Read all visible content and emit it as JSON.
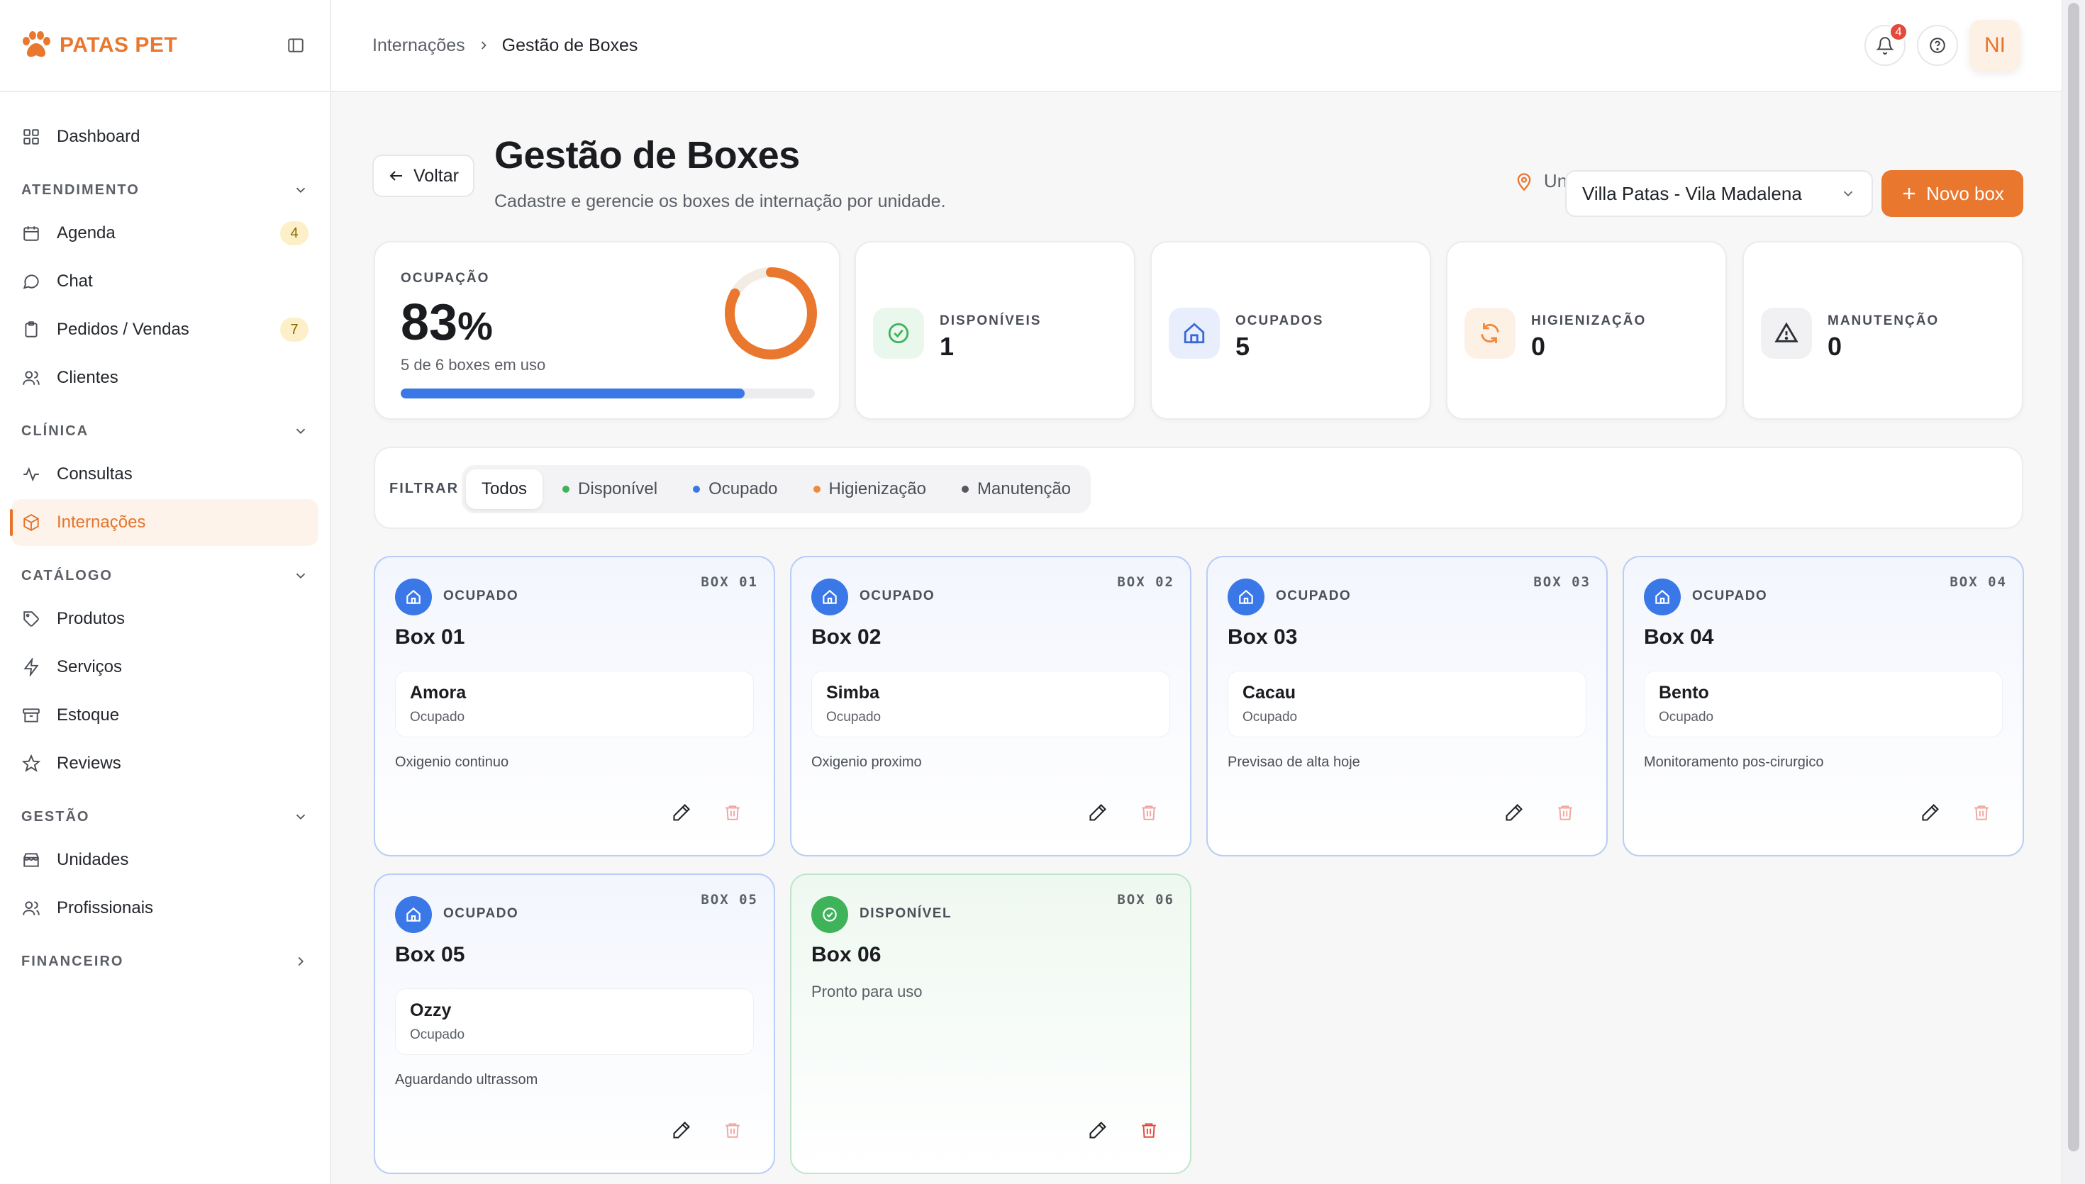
{
  "brand": {
    "name": "PATAS PET"
  },
  "sidebar": {
    "dashboard": "Dashboard",
    "sections": {
      "atendimento": "ATENDIMENTO",
      "clinica": "CLÍNICA",
      "catalogo": "CATÁLOGO",
      "gestao": "GESTÃO",
      "financeiro": "FINANCEIRO"
    },
    "items": {
      "agenda": {
        "label": "Agenda",
        "badge": "4"
      },
      "chat": {
        "label": "Chat"
      },
      "pedidos": {
        "label": "Pedidos / Vendas",
        "badge": "7"
      },
      "clientes": {
        "label": "Clientes"
      },
      "consultas": {
        "label": "Consultas"
      },
      "internacoes": {
        "label": "Internações"
      },
      "produtos": {
        "label": "Produtos"
      },
      "servicos": {
        "label": "Serviços"
      },
      "estoque": {
        "label": "Estoque"
      },
      "reviews": {
        "label": "Reviews"
      },
      "unidades": {
        "label": "Unidades"
      },
      "profissionais": {
        "label": "Profissionais"
      }
    }
  },
  "topbar": {
    "breadcrumb": [
      "Internações",
      "Gestão de Boxes"
    ],
    "notifications_count": "4",
    "avatar_initials": "NI"
  },
  "page": {
    "back_label": "Voltar",
    "title": "Gestão de Boxes",
    "subtitle": "Cadastre e gerencie os boxes de internação por unidade.",
    "unit_label": "Unidade:",
    "unit_value": "Villa Patas - Vila Madalena",
    "new_box_label": "Novo box"
  },
  "stats": {
    "occupancy": {
      "label": "OCUPAÇÃO",
      "value": "83",
      "unit": "%",
      "sub": "5 de 6 boxes em uso",
      "fraction": 0.83
    },
    "disponiveis": {
      "label": "DISPONÍVEIS",
      "value": "1"
    },
    "ocupados": {
      "label": "OCUPADOS",
      "value": "5"
    },
    "higienizacao": {
      "label": "HIGIENIZAÇÃO",
      "value": "0"
    },
    "manutencao": {
      "label": "MANUTENÇÃO",
      "value": "0"
    }
  },
  "filter": {
    "label": "FILTRAR",
    "options": [
      "Todos",
      "Disponível",
      "Ocupado",
      "Higienização",
      "Manutenção"
    ],
    "selected": "Todos"
  },
  "colors": {
    "brand": "#e9772e",
    "occupied": "#3b78e7",
    "available": "#3fb35a",
    "cleaning": "#f08a3a",
    "maintenance": "#55595f"
  },
  "boxes": [
    {
      "code": "BOX 01",
      "status": "OCUPADO",
      "name": "Box 01",
      "pet": "Amora",
      "pet_status": "Ocupado",
      "note": "Oxigenio continuo"
    },
    {
      "code": "BOX 02",
      "status": "OCUPADO",
      "name": "Box 02",
      "pet": "Simba",
      "pet_status": "Ocupado",
      "note": "Oxigenio proximo"
    },
    {
      "code": "BOX 03",
      "status": "OCUPADO",
      "name": "Box 03",
      "pet": "Cacau",
      "pet_status": "Ocupado",
      "note": "Previsao de alta hoje"
    },
    {
      "code": "BOX 04",
      "status": "OCUPADO",
      "name": "Box 04",
      "pet": "Bento",
      "pet_status": "Ocupado",
      "note": "Monitoramento pos-cirurgico"
    },
    {
      "code": "BOX 05",
      "status": "OCUPADO",
      "name": "Box 05",
      "pet": "Ozzy",
      "pet_status": "Ocupado",
      "note": "Aguardando ultrassom"
    },
    {
      "code": "BOX 06",
      "status": "DISPONÍVEL",
      "name": "Box 06",
      "ready": "Pronto para uso"
    }
  ]
}
